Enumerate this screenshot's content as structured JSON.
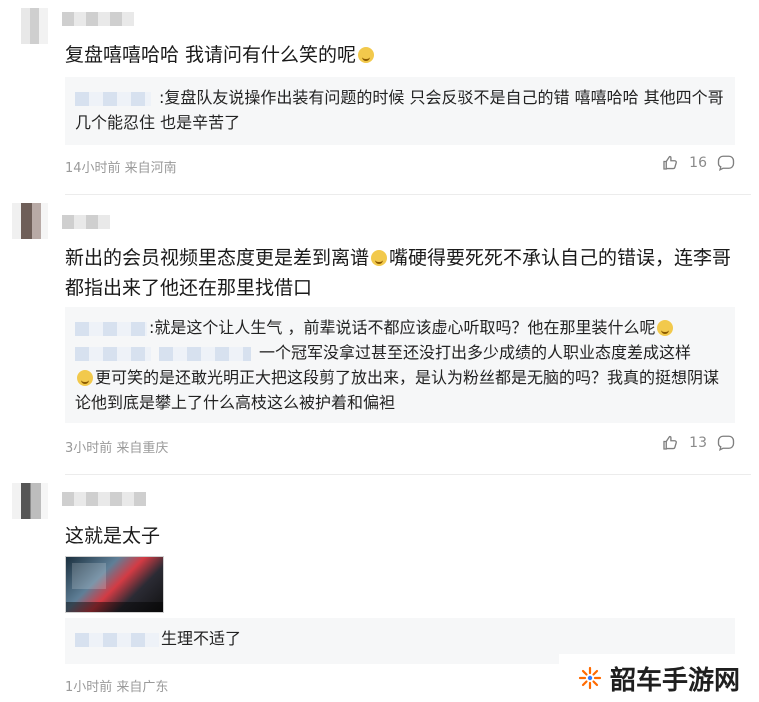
{
  "comments": [
    {
      "text": "复盘嘻嘻哈哈 我请问有什么笑的呢",
      "reply": ":复盘队友说操作出装有问题的时候 只会反驳不是自己的错 嘻嘻哈哈 其他四个哥几个能忍住 也是辛苦了",
      "meta": "14小时前 来自河南",
      "likes": "16"
    },
    {
      "text_part1": "新出的会员视频里态度更是差到离谱",
      "text_part2": "嘴硬得要死死不承认自己的错误，连李哥都指出来了他还在那里找借口",
      "reply_part1": ":就是这个让人生气 ，前辈说话不都应该虚心听取吗？他在那里装什么呢",
      "reply_part2": "一个冠军没拿过甚至还没打出多少成绩的人职业态度差成这样",
      "reply_part3": "更可笑的是还敢光明正大把这段剪了放出来，是认为粉丝都是无脑的吗？我真的挺想阴谋论他到底是攀上了什么高枝这么被护着和偏袒",
      "meta": "3小时前 来自重庆",
      "likes": "13"
    },
    {
      "text": "这就是太子",
      "reply": "生理不适了",
      "meta": "1小时前 来自广东"
    }
  ],
  "watermark": {
    "text": "韶车手游网"
  },
  "icons": {
    "like": "thumbs-up-icon",
    "comment": "comment-icon"
  }
}
